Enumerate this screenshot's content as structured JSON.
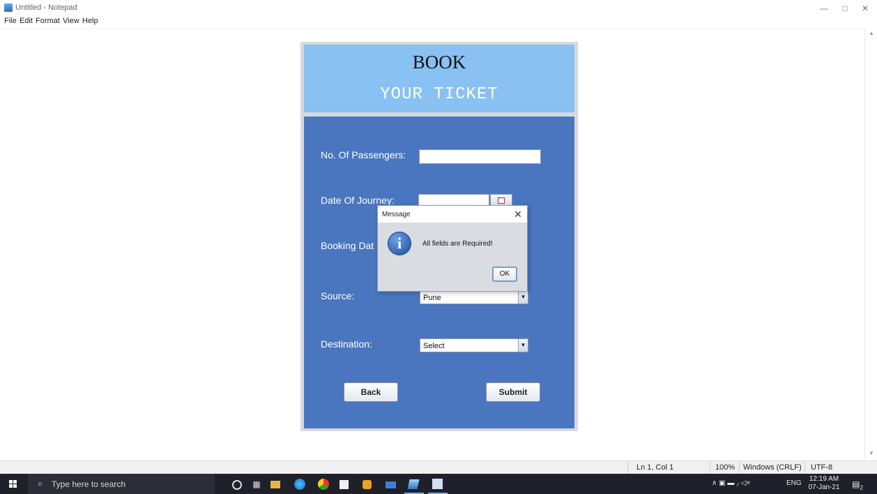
{
  "notepad": {
    "title": "Untitled - Notepad",
    "menu": [
      "File",
      "Edit",
      "Format",
      "View",
      "Help"
    ],
    "status": {
      "position": "Ln 1, Col 1",
      "zoom": "100%",
      "line_ending": "Windows (CRLF)",
      "encoding": "UTF-8"
    },
    "window_controls": {
      "minimize": "—",
      "maximize": "□",
      "close": "✕"
    }
  },
  "booking": {
    "title": "BOOK",
    "subtitle": "YOUR TICKET",
    "fields": {
      "passengers_label": "No. Of Passengers:",
      "passengers_value": "",
      "journey_date_label": "Date Of Journey:",
      "journey_date_value": "",
      "booking_date_label": "Booking Dat",
      "source_label": "Source:",
      "source_value": "Pune",
      "destination_label": "Destination:",
      "destination_value": "Select"
    },
    "buttons": {
      "back": "Back",
      "submit": "Submit"
    }
  },
  "dialog": {
    "title": "Message",
    "message": "All fields are Required!",
    "ok": "OK",
    "close_glyph": "✕",
    "icon": "info-icon",
    "icon_glyph": "i"
  },
  "taskbar": {
    "search_placeholder": "Type here to search",
    "search_glyph": "⌕",
    "icons": [
      "cortana-icon",
      "task-view-icon",
      "file-explorer-icon",
      "edge-icon",
      "chrome-icon",
      "store-icon",
      "app-icon",
      "mail-icon",
      "notepad-icon",
      "java-icon"
    ],
    "tray_language": "ENG",
    "tray_glyphs": "∧  ▣  ▬  ◞  ◁×",
    "time": "12:19 AM",
    "date": "07-Jan-21",
    "notifications": "2"
  },
  "colors": {
    "header_panel": "#88c1f2",
    "form_panel": "#4a76bf",
    "taskbar": "#1f2029"
  }
}
